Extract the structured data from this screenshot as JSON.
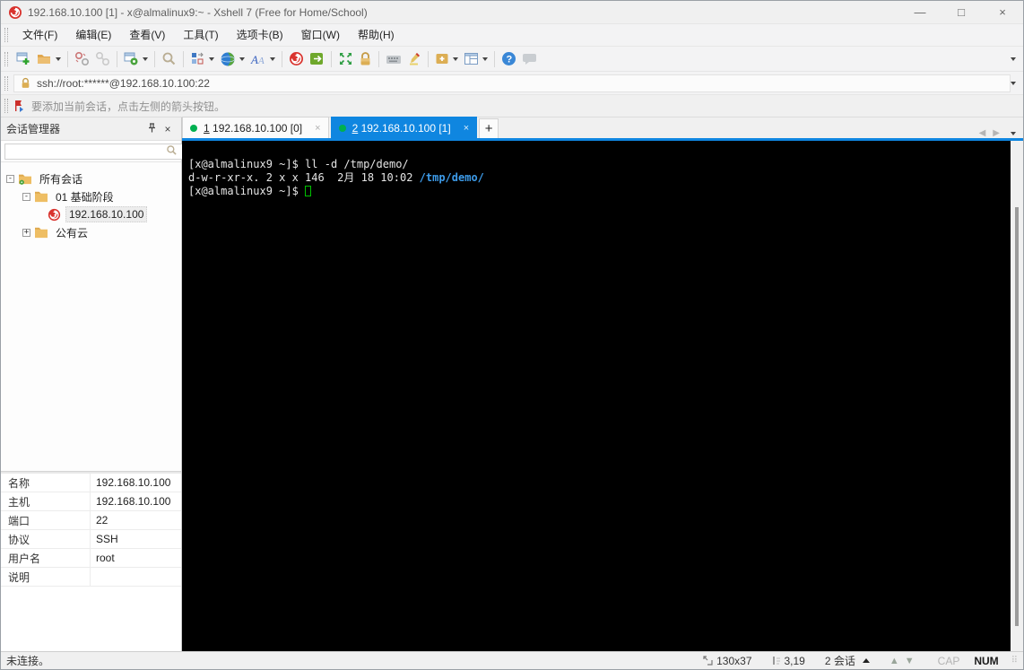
{
  "window": {
    "title": "192.168.10.100 [1] - x@almalinux9:~ - Xshell 7 (Free for Home/School)",
    "minimize": "—",
    "maximize": "□",
    "close": "×"
  },
  "menu": {
    "items": [
      "文件(F)",
      "编辑(E)",
      "查看(V)",
      "工具(T)",
      "选项卡(B)",
      "窗口(W)",
      "帮助(H)"
    ]
  },
  "toolbar": {
    "icons": [
      "new-session",
      "open-session",
      "disconnect",
      "reconnect",
      "session-properties",
      "find",
      "window-layout",
      "encoding-globe",
      "font",
      "xshell",
      "xftp",
      "fullscreen",
      "lock-screen",
      "virtual-keyboard",
      "compose-pen",
      "new-file-transfer",
      "tile-windows",
      "help",
      "feedback"
    ]
  },
  "address_bar": {
    "value": "ssh://root:******@192.168.10.100:22"
  },
  "info_bar": {
    "text": "要添加当前会话，点击左侧的箭头按钮。"
  },
  "session_manager": {
    "title": "会话管理器",
    "close": "×",
    "tree": [
      {
        "label": "所有会话",
        "expander": "-"
      },
      {
        "label": "01 基础阶段",
        "expander": "-"
      },
      {
        "label": "192.168.10.100"
      },
      {
        "label": "公有云",
        "expander": "+"
      }
    ]
  },
  "tab_bar": {
    "tabs": [
      {
        "num": "1",
        "label": " 192.168.10.100 [0]",
        "close": "×",
        "state": "connected"
      },
      {
        "num": "2",
        "label": " 192.168.10.100 [1]",
        "close": "×",
        "state": "connected"
      }
    ],
    "new_tab": "+"
  },
  "terminal": {
    "line1": "[x@almalinux9 ~]$ ll -d /tmp/demo/",
    "line2_pre": "d-w-r-xr-x. 2 x x 146  2月 18 10:02 ",
    "line2_dir": "/tmp/demo/",
    "prompt": "[x@almalinux9 ~]$ "
  },
  "properties": {
    "rows": [
      {
        "label": "名称",
        "value": "192.168.10.100"
      },
      {
        "label": "主机",
        "value": "192.168.10.100"
      },
      {
        "label": "端口",
        "value": "22"
      },
      {
        "label": "协议",
        "value": "SSH"
      },
      {
        "label": "用户名",
        "value": "root"
      },
      {
        "label": "说明",
        "value": ""
      }
    ]
  },
  "status_bar": {
    "left": "未连接。",
    "size": "130x37",
    "cursor_pos": "3,19",
    "sessions": "2 会话",
    "cap": "CAP",
    "num": "NUM"
  },
  "colors": {
    "accent_blue": "#0f86e0",
    "terminal_dir_blue": "#3d9be9",
    "cursor_green": "#00c000",
    "tab_dot_green": "#00b050",
    "xshell_red": "#d9332e",
    "lock_gold": "#d9a43a"
  }
}
